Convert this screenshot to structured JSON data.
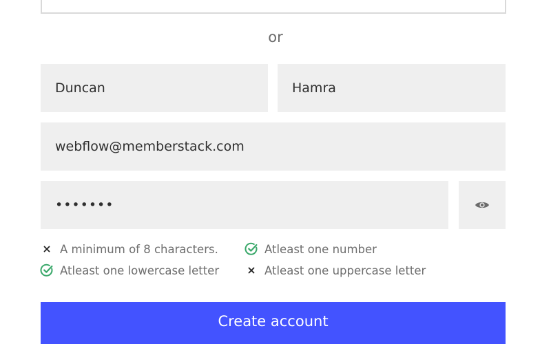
{
  "divider": {
    "label": "or"
  },
  "form": {
    "first_name": {
      "value": "Duncan"
    },
    "last_name": {
      "value": "Hamra"
    },
    "email": {
      "value": "webflow@memberstack.com"
    },
    "password": {
      "masked_value": "•••••••"
    },
    "toggle_icon": "eye-icon"
  },
  "requirements": [
    {
      "label": "A minimum of 8 characters.",
      "met": false,
      "icon": "x-icon"
    },
    {
      "label": "Atleast one number",
      "met": true,
      "icon": "check-circle-icon"
    },
    {
      "label": "Atleast one lowercase letter",
      "met": true,
      "icon": "check-circle-icon"
    },
    {
      "label": "Atleast one uppercase letter",
      "met": false,
      "icon": "x-icon"
    }
  ],
  "submit": {
    "label": "Create account"
  },
  "colors": {
    "accent": "#4353ff",
    "field_bg": "#efefef",
    "check_green": "#3aa86a",
    "divider_text": "#6b6b6b"
  }
}
